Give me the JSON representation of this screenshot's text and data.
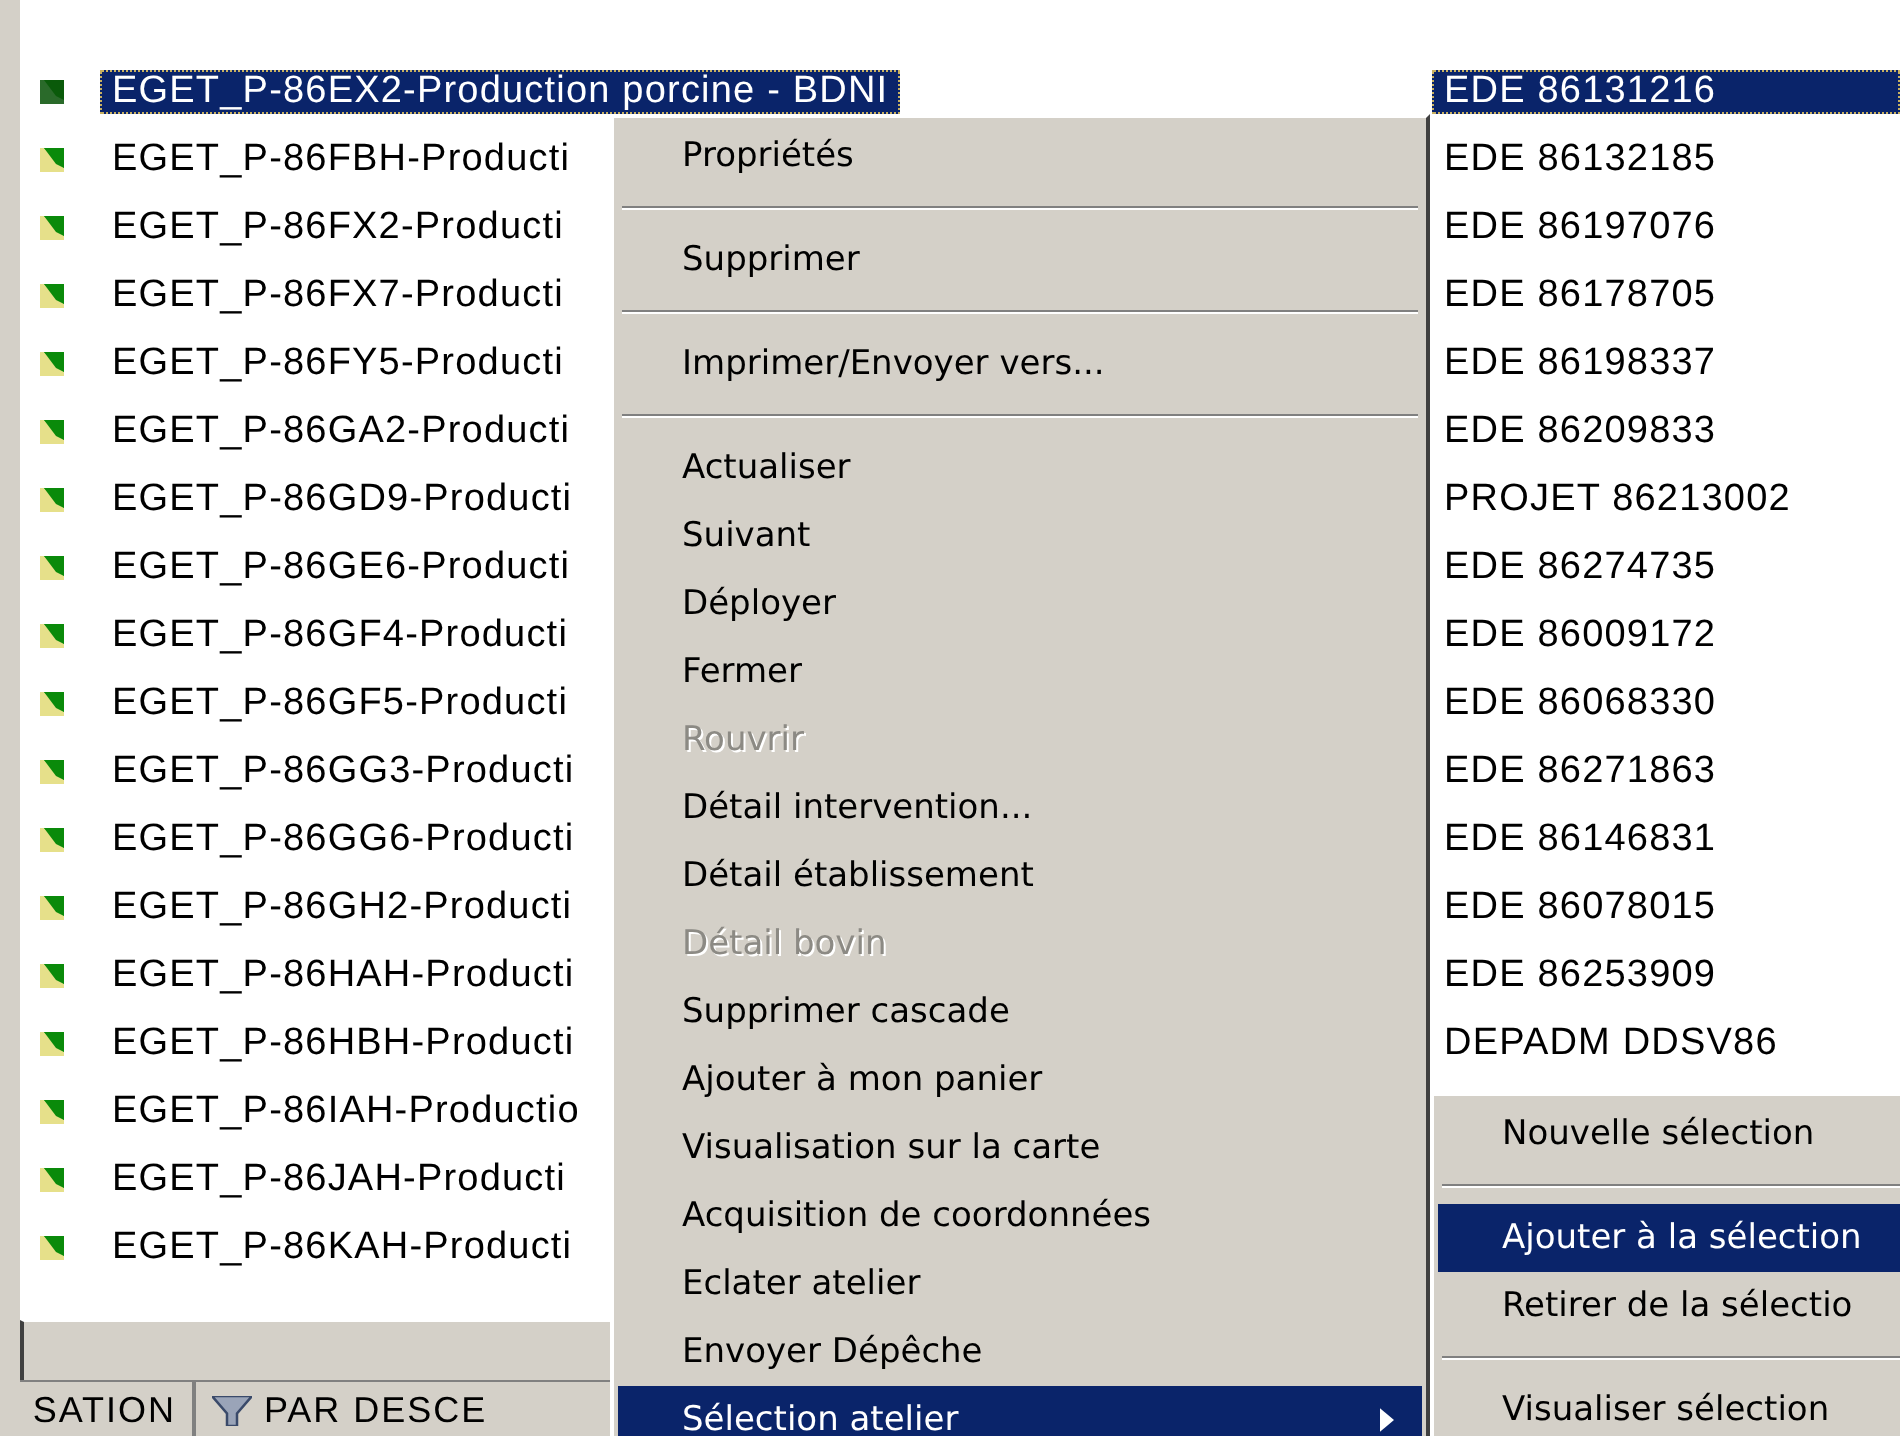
{
  "list": {
    "rows": [
      {
        "name": "EGET_P-86EX2-Production porcine - BDNI",
        "code": "EDE 86131216",
        "selected": true
      },
      {
        "name": "EGET_P-86FBH-Producti",
        "code": "EDE 86132185",
        "selected": false
      },
      {
        "name": "EGET_P-86FX2-Producti",
        "code": "EDE 86197076",
        "selected": false
      },
      {
        "name": "EGET_P-86FX7-Producti",
        "code": "EDE 86178705",
        "selected": false
      },
      {
        "name": "EGET_P-86FY5-Producti",
        "code": "EDE 86198337",
        "selected": false
      },
      {
        "name": "EGET_P-86GA2-Producti",
        "code": "EDE 86209833",
        "selected": false
      },
      {
        "name": "EGET_P-86GD9-Producti",
        "code": "PROJET 86213002",
        "selected": false
      },
      {
        "name": "EGET_P-86GE6-Producti",
        "code": "EDE 86274735",
        "selected": false
      },
      {
        "name": "EGET_P-86GF4-Producti",
        "code": "EDE 86009172",
        "selected": false
      },
      {
        "name": "EGET_P-86GF5-Producti",
        "code": "EDE 86068330",
        "selected": false
      },
      {
        "name": "EGET_P-86GG3-Producti",
        "code": "EDE 86271863",
        "selected": false
      },
      {
        "name": "EGET_P-86GG6-Producti",
        "code": "EDE 86146831",
        "selected": false
      },
      {
        "name": "EGET_P-86GH2-Producti",
        "code": "EDE 86078015",
        "selected": false
      },
      {
        "name": "EGET_P-86HAH-Producti",
        "code": "EDE 86253909",
        "selected": false
      },
      {
        "name": "EGET_P-86HBH-Producti",
        "code": "DEPADM DDSV86",
        "selected": false
      },
      {
        "name": "EGET_P-86IAH-Productio",
        "code": "",
        "selected": false
      },
      {
        "name": "EGET_P-86JAH-Producti",
        "code": "",
        "selected": false
      },
      {
        "name": "EGET_P-86KAH-Producti",
        "code": "",
        "selected": false
      }
    ]
  },
  "status_bar": {
    "panels": [
      {
        "label": "SATION",
        "kind": "text"
      },
      {
        "label": "PAR DESCE",
        "kind": "filter"
      }
    ]
  },
  "context_menu": {
    "items": [
      {
        "label": "Propriétés",
        "kind": "item",
        "disabled": false,
        "selected": false
      },
      {
        "kind": "separator"
      },
      {
        "label": "Supprimer",
        "kind": "item",
        "disabled": false,
        "selected": false
      },
      {
        "kind": "separator"
      },
      {
        "label": "Imprimer/Envoyer vers...",
        "kind": "item",
        "disabled": false,
        "selected": false
      },
      {
        "kind": "separator"
      },
      {
        "label": "Actualiser",
        "kind": "item",
        "disabled": false,
        "selected": false
      },
      {
        "label": "Suivant",
        "kind": "item",
        "disabled": false,
        "selected": false
      },
      {
        "label": "Déployer",
        "kind": "item",
        "disabled": false,
        "selected": false
      },
      {
        "label": "Fermer",
        "kind": "item",
        "disabled": false,
        "selected": false
      },
      {
        "label": "Rouvrir",
        "kind": "item",
        "disabled": true,
        "selected": false
      },
      {
        "label": "Détail intervention...",
        "kind": "item",
        "disabled": false,
        "selected": false
      },
      {
        "label": "Détail établissement",
        "kind": "item",
        "disabled": false,
        "selected": false
      },
      {
        "label": "Détail bovin",
        "kind": "item",
        "disabled": true,
        "selected": false
      },
      {
        "label": "Supprimer cascade",
        "kind": "item",
        "disabled": false,
        "selected": false
      },
      {
        "label": "Ajouter à mon panier",
        "kind": "item",
        "disabled": false,
        "selected": false
      },
      {
        "label": "Visualisation sur la carte",
        "kind": "item",
        "disabled": false,
        "selected": false
      },
      {
        "label": "Acquisition de coordonnées",
        "kind": "item",
        "disabled": false,
        "selected": false
      },
      {
        "label": "Eclater atelier",
        "kind": "item",
        "disabled": false,
        "selected": false
      },
      {
        "label": "Envoyer Dépêche",
        "kind": "item",
        "disabled": false,
        "selected": false
      },
      {
        "label": "Sélection atelier",
        "kind": "submenu",
        "disabled": false,
        "selected": true
      }
    ]
  },
  "submenu": {
    "items": [
      {
        "label": "Nouvelle sélection",
        "kind": "item",
        "selected": false
      },
      {
        "kind": "separator"
      },
      {
        "label": "Ajouter à la sélection",
        "kind": "item",
        "selected": true
      },
      {
        "label": "Retirer de la sélectio",
        "kind": "item",
        "selected": false
      },
      {
        "kind": "separator"
      },
      {
        "label": "Visualiser sélection",
        "kind": "item",
        "selected": false
      }
    ]
  }
}
